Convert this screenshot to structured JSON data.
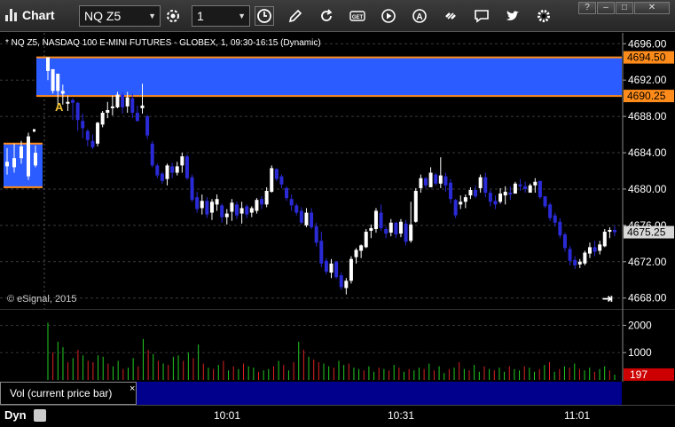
{
  "window": {
    "title": "Chart"
  },
  "toolbar": {
    "symbol": "NQ Z5",
    "interval": "1",
    "buttons": [
      "settings-icon",
      "clock-icon",
      "pencil-icon",
      "refresh-icon",
      "get-icon",
      "play-icon",
      "alert-icon",
      "link-icon",
      "comment-icon",
      "twitter-icon",
      "gear-icon"
    ]
  },
  "header": {
    "description": "* NQ Z5, NASDAQ 100 E-MINI FUTURES - GLOBEX, 1, 09:30-16:15 (Dynamic)"
  },
  "footer": {
    "copyright": "© eSignal, 2015",
    "mode": "Dyn"
  },
  "colors": {
    "up": "#ffffff",
    "down": "#2a2ad6",
    "zone": "#2b5cff",
    "zone_edge": "#ff8c1a",
    "vol_up": "#22cc22",
    "vol_down": "#dd2222",
    "current": "#cc0000"
  },
  "chart_data": [
    {
      "type": "candlestick",
      "title": "",
      "xlabel": "",
      "ylabel": "",
      "ylim": [
        4666.8,
        4697.2
      ],
      "y_ticks": [
        "4696.00",
        "4692.00",
        "4688.00",
        "4684.00",
        "4680.00",
        "4676.00",
        "4672.00",
        "4668.00"
      ],
      "x_ticks": [
        "10:01",
        "10:31",
        "11:01"
      ],
      "zones": [
        {
          "low": 4690.25,
          "high": 4694.5,
          "low_label": "4690.25",
          "high_label": "4694.50"
        },
        {
          "low": 4680.2,
          "high": 4685.0
        }
      ],
      "current_price": {
        "value": 4675.25,
        "label": "4675.25"
      },
      "annotations": [
        {
          "text": "A",
          "price": 4689.0
        }
      ],
      "grid": true,
      "candles": [
        [
          4694.5,
          4692,
          4693,
          4694.5
        ],
        [
          4693,
          4690.5,
          4690.8,
          4693.2
        ],
        [
          4692.5,
          4689,
          4690.8,
          4692.7
        ],
        [
          4691.5,
          4689.3,
          4690.5,
          4690.8
        ],
        [
          4690.3,
          4688.6,
          4689.4,
          4689.6
        ],
        [
          4690,
          4687.6,
          4689.8,
          4689.5
        ],
        [
          4689.6,
          4686.4,
          4689.5,
          4687.6
        ],
        [
          4688.3,
          4685.6,
          4687.5,
          4686.7
        ],
        [
          4686.6,
          4684.7,
          4686.4,
          4685.4
        ],
        [
          4686,
          4684.4,
          4685.3,
          4684.6
        ],
        [
          4687.4,
          4684.7,
          4685,
          4687.3
        ],
        [
          4688.6,
          4686.8,
          4687.1,
          4688.4
        ],
        [
          4689.6,
          4687.8,
          4688.4,
          4688.7
        ],
        [
          4690.3,
          4688.1,
          4688.9,
          4689.1
        ],
        [
          4690.7,
          4688.9,
          4689,
          4690.4
        ],
        [
          4690.7,
          4688.3,
          4690.4,
          4689
        ],
        [
          4690.7,
          4688.4,
          4689.1,
          4690.1
        ],
        [
          4690.5,
          4687.8,
          4690,
          4688.4
        ],
        [
          4689.2,
          4687.4,
          4688.4,
          4687.5
        ],
        [
          4691.6,
          4688.3,
          4688.9,
          4689.2
        ],
        [
          4688.2,
          4685.5,
          4688,
          4685.9
        ],
        [
          4685.3,
          4682.4,
          4685,
          4682.6
        ],
        [
          4682.8,
          4681.2,
          4682.6,
          4681.5
        ],
        [
          4681.9,
          4680.6,
          4681.7,
          4680.9
        ],
        [
          4682.8,
          4680.4,
          4681.1,
          4682.6
        ],
        [
          4682.9,
          4681.2,
          4682.5,
          4681.8
        ],
        [
          4683,
          4681.5,
          4681.8,
          4682.5
        ],
        [
          4684,
          4681.8,
          4682.6,
          4683.6
        ],
        [
          4683.8,
          4681,
          4683.6,
          4681.2
        ],
        [
          4681.6,
          4678.6,
          4681.3,
          4678.8
        ],
        [
          4679.7,
          4677.4,
          4679.1,
          4677.8
        ],
        [
          4679.4,
          4677.2,
          4677.9,
          4678.7
        ],
        [
          4679.1,
          4676.8,
          4678.7,
          4677.2
        ],
        [
          4678.9,
          4676.6,
          4677.4,
          4678.6
        ],
        [
          4679.4,
          4677.6,
          4678.3,
          4678.9
        ],
        [
          4678.4,
          4676.3,
          4678.2,
          4676.9
        ],
        [
          4677.8,
          4676.1,
          4676.9,
          4677.3
        ],
        [
          4678.9,
          4676.5,
          4677.5,
          4678.5
        ],
        [
          4678.6,
          4676.7,
          4678.3,
          4677.1
        ],
        [
          4678.6,
          4676.2,
          4677.3,
          4677.9
        ],
        [
          4678.3,
          4676.8,
          4678.1,
          4677.2
        ],
        [
          4678.1,
          4676.9,
          4677.4,
          4677.9
        ],
        [
          4679,
          4677.3,
          4677.6,
          4678.8
        ],
        [
          4679.2,
          4677.8,
          4678.9,
          4678.3
        ],
        [
          4680.2,
          4678,
          4678.3,
          4679.8
        ],
        [
          4682.6,
          4679.6,
          4679.7,
          4682.3
        ],
        [
          4682.3,
          4680.9,
          4682.2,
          4681.1
        ],
        [
          4681.6,
          4680.1,
          4681.4,
          4680.5
        ],
        [
          4680.3,
          4678.7,
          4680.1,
          4679
        ],
        [
          4679.4,
          4677.6,
          4678.9,
          4678.2
        ],
        [
          4678.4,
          4677.1,
          4678.2,
          4677.4
        ],
        [
          4678,
          4676.1,
          4677.6,
          4676.3
        ],
        [
          4677.9,
          4675.8,
          4676,
          4677.4
        ],
        [
          4677.9,
          4675.6,
          4677.4,
          4675.8
        ],
        [
          4676.3,
          4673.7,
          4675.9,
          4674.1
        ],
        [
          4675.3,
          4671.4,
          4674.3,
          4671.8
        ],
        [
          4672.4,
          4670.6,
          4672.1,
          4670.9
        ],
        [
          4672.3,
          4670.2,
          4670.8,
          4671.8
        ],
        [
          4672.1,
          4670.1,
          4672,
          4670.3
        ],
        [
          4670.8,
          4668.9,
          4670.5,
          4669.2
        ],
        [
          4670.2,
          4668.4,
          4669.1,
          4669.9
        ],
        [
          4672.6,
          4669.6,
          4669.9,
          4672.3
        ],
        [
          4673.5,
          4671.8,
          4672.5,
          4673.3
        ],
        [
          4673.9,
          4672.4,
          4673.2,
          4673.8
        ],
        [
          4675.6,
          4673.5,
          4673.6,
          4675.3
        ],
        [
          4676.1,
          4674.6,
          4675.4,
          4675.7
        ],
        [
          4677.9,
          4675.2,
          4675.6,
          4677.6
        ],
        [
          4678.3,
          4675.4,
          4677.4,
          4675.7
        ],
        [
          4675.9,
          4674.6,
          4675.6,
          4675.1
        ],
        [
          4676.7,
          4674.8,
          4675.2,
          4676.3
        ],
        [
          4676.4,
          4674.6,
          4676.3,
          4675
        ],
        [
          4676.7,
          4674.7,
          4675.1,
          4676.4
        ],
        [
          4676.6,
          4673.8,
          4676.2,
          4674.2
        ],
        [
          4678.6,
          4674.1,
          4674.3,
          4676.1
        ],
        [
          4680.1,
          4676.3,
          4676.4,
          4679.8
        ],
        [
          4681.6,
          4679.6,
          4680.1,
          4681.2
        ],
        [
          4681.3,
          4680.1,
          4681.2,
          4680.4
        ],
        [
          4682.4,
          4680.2,
          4680.2,
          4681.8
        ],
        [
          4681.8,
          4680.4,
          4681.6,
          4680.6
        ],
        [
          4683.5,
          4680.1,
          4680.6,
          4681.5
        ],
        [
          4681.8,
          4679.7,
          4681.4,
          4680.4
        ],
        [
          4681.1,
          4678.4,
          4680.7,
          4678.9
        ],
        [
          4678.9,
          4676.8,
          4678.8,
          4677.1
        ],
        [
          4679.3,
          4677.8,
          4678.3,
          4678.6
        ],
        [
          4679.4,
          4677.9,
          4678.6,
          4679.1
        ],
        [
          4680.2,
          4678.9,
          4679.3,
          4679.9
        ],
        [
          4680.4,
          4679,
          4679.9,
          4679.2
        ],
        [
          4681.6,
          4679.6,
          4680.1,
          4681.3
        ],
        [
          4681.8,
          4679.1,
          4681.3,
          4679.6
        ],
        [
          4679.9,
          4678.1,
          4679.6,
          4678.6
        ],
        [
          4679.3,
          4677.8,
          4678.7,
          4678.3
        ],
        [
          4680.1,
          4678.4,
          4678.6,
          4679.5
        ],
        [
          4680.3,
          4678.3,
          4679.3,
          4679.7
        ],
        [
          4680.3,
          4678.8,
          4679.6,
          4679.4
        ],
        [
          4680.8,
          4679.5,
          4679.5,
          4680.6
        ],
        [
          4681.1,
          4679.8,
          4680.5,
          4680.3
        ],
        [
          4680.8,
          4679.6,
          4680.3,
          4680
        ],
        [
          4680.6,
          4679.7,
          4679.6,
          4680.4
        ],
        [
          4681.2,
          4679.6,
          4680.4,
          4680.8
        ],
        [
          4680.6,
          4678.9,
          4680.9,
          4679.1
        ],
        [
          4679.2,
          4677.9,
          4679.2,
          4678.1
        ],
        [
          4678.5,
          4676.5,
          4678.3,
          4676.8
        ],
        [
          4677.4,
          4675.9,
          4677.1,
          4676.3
        ],
        [
          4676.8,
          4674.6,
          4676.4,
          4674.9
        ],
        [
          4675.2,
          4673.1,
          4675,
          4673.5
        ],
        [
          4673.7,
          4671.6,
          4673.4,
          4672.1
        ],
        [
          4672.6,
          4671.2,
          4672.2,
          4671.6
        ],
        [
          4672.3,
          4671.3,
          4671.7,
          4672
        ],
        [
          4673.2,
          4671.6,
          4671.8,
          4673
        ],
        [
          4674.1,
          4672.4,
          4672.9,
          4673.6
        ],
        [
          4674.3,
          4672.6,
          4673.6,
          4673.1
        ],
        [
          4674.3,
          4672.8,
          4673.2,
          4673.9
        ],
        [
          4675.6,
          4673.6,
          4673.7,
          4675.3
        ],
        [
          4675.8,
          4674.6,
          4675.3,
          4675.5
        ],
        [
          4676,
          4674.8,
          4675.5,
          4675.25
        ]
      ]
    },
    {
      "type": "bar",
      "title": "",
      "xlabel": "",
      "ylabel": "",
      "ylim": [
        0,
        2600
      ],
      "y_ticks": [
        "2000",
        "1000"
      ],
      "current_value": {
        "value": 197,
        "label": "197"
      },
      "values": [
        2100,
        1000,
        1400,
        1200,
        650,
        800,
        1100,
        900,
        700,
        650,
        900,
        850,
        600,
        500,
        700,
        400,
        450,
        800,
        500,
        1500,
        1100,
        950,
        700,
        600,
        550,
        850,
        900,
        700,
        1000,
        800,
        1300,
        600,
        450,
        400,
        550,
        700,
        350,
        500,
        400,
        600,
        500,
        450,
        300,
        350,
        400,
        500,
        700,
        550,
        350,
        650,
        1400,
        1100,
        850,
        750,
        650,
        600,
        500,
        450,
        700,
        550,
        600,
        450,
        400,
        350,
        500,
        300,
        450,
        400,
        350,
        550,
        450,
        300,
        400,
        350,
        450,
        400,
        600,
        350,
        500,
        250,
        400,
        450,
        650,
        400,
        350,
        550,
        300,
        500,
        400,
        350,
        450,
        300,
        500,
        400,
        350,
        500,
        450,
        300,
        400,
        550,
        650,
        300,
        400,
        500,
        450,
        600,
        400,
        350,
        450,
        300,
        400,
        500,
        350,
        197
      ],
      "up": [
        1,
        0,
        1,
        1,
        0,
        1,
        0,
        1,
        0,
        0,
        1,
        1,
        0,
        1,
        1,
        0,
        1,
        1,
        0,
        1,
        0,
        1,
        0,
        1,
        0,
        1,
        1,
        0,
        1,
        0,
        1,
        0,
        1,
        0,
        1,
        0,
        1,
        0,
        1,
        0,
        1,
        1,
        0,
        1,
        1,
        0,
        1,
        0,
        1,
        0,
        1,
        0,
        1,
        0,
        0,
        1,
        1,
        0,
        1,
        1,
        0,
        1,
        1,
        0,
        1,
        1,
        0,
        1,
        0,
        1,
        0,
        1,
        0,
        1,
        1,
        0,
        1,
        0,
        1,
        1,
        0,
        1,
        0,
        1,
        0,
        1,
        1,
        0,
        1,
        0,
        1,
        1,
        0,
        1,
        1,
        0,
        1,
        1,
        0,
        1,
        0,
        1,
        0,
        1,
        0,
        1,
        0,
        1,
        1,
        0,
        1,
        1,
        0,
        1,
        0
      ]
    }
  ],
  "panel": {
    "vol_label": "Vol (current price bar)",
    "close_glyph": "×"
  }
}
